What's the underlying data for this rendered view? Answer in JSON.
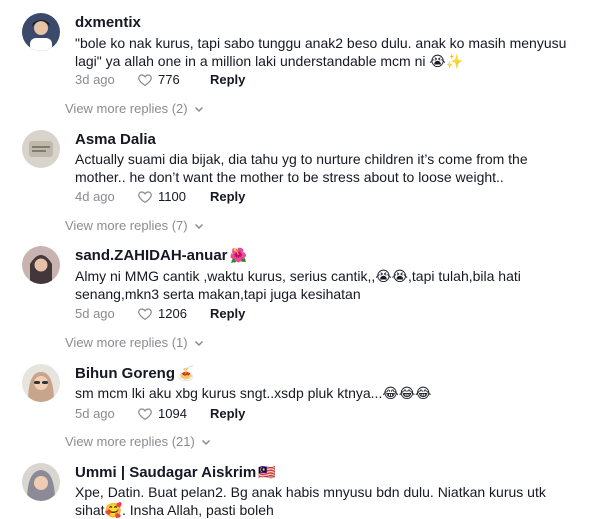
{
  "comments": [
    {
      "username": "dxmentix",
      "badge": "",
      "text": "\"bole ko nak kurus, tapi sabo tunggu anak2 beso dulu. anak ko masih menyusu lagi\" ya allah one in a million laki understandable mcm ni 😭✨",
      "date": "3d ago",
      "likes": "776",
      "reply_label": "Reply",
      "view_replies": "View more replies (2)",
      "avatar_icon": "user-avatar-icon"
    },
    {
      "username": "Asma Dalia",
      "badge": "",
      "text": "Actually suami dia bijak, dia tahu yg to nurture children it’s come from the mother.. he don’t want the mother to be stress about to loose weight..",
      "date": "4d ago",
      "likes": "1100",
      "reply_label": "Reply",
      "view_replies": "View more replies (7)",
      "avatar_icon": "user-avatar-icon"
    },
    {
      "username": "sand.ZAHIDAH-anuar",
      "badge": "🌺",
      "text": "Almy ni MMG cantik ,waktu kurus, serius cantik,,😭😭,tapi tulah,bila hati senang,mkn3 serta makan,tapi juga kesihatan",
      "date": "5d ago",
      "likes": "1206",
      "reply_label": "Reply",
      "view_replies": "View more replies (1)",
      "avatar_icon": "user-avatar-icon"
    },
    {
      "username": "Bihun Goreng",
      "badge": "🍝",
      "text": "sm mcm lki aku xbg kurus sngt..xsdp pluk ktnya...😂😂😂",
      "date": "5d ago",
      "likes": "1094",
      "reply_label": "Reply",
      "view_replies": "View more replies (21)",
      "avatar_icon": "user-avatar-icon"
    },
    {
      "username": "Ummi | Saudagar Aiskrim",
      "badge": "🇲🇾",
      "text": "Xpe, Datin. Buat pelan2. Bg anak habis mnyusu bdn dulu. Niatkan kurus utk sihat🥰. Insha Allah, pasti boleh",
      "date": "",
      "likes": "",
      "reply_label": "",
      "view_replies": "",
      "avatar_icon": "user-avatar-icon"
    }
  ],
  "colors": {
    "text_primary": "#161823",
    "text_secondary": "#8a8b91",
    "background": "#ffffff"
  },
  "icons": {
    "like": "heart-outline-icon",
    "expand": "chevron-down-icon"
  }
}
